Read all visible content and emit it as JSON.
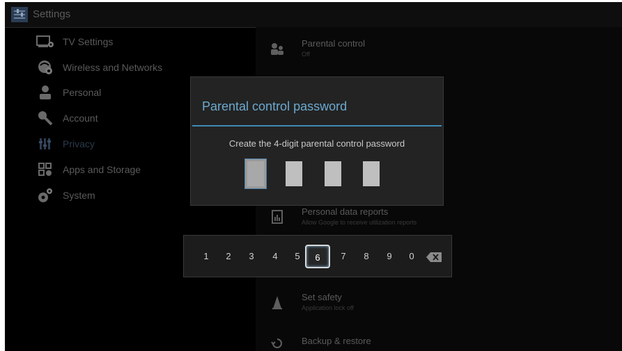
{
  "header": {
    "title": "Settings",
    "icon": "settings-app-icon"
  },
  "menu": {
    "items": [
      {
        "label": "TV Settings",
        "icon": "tv-settings-icon"
      },
      {
        "label": "Wireless and Networks",
        "icon": "network-icon"
      },
      {
        "label": "Personal",
        "icon": "person-icon"
      },
      {
        "label": "Account",
        "icon": "key-icon"
      },
      {
        "label": "Privacy",
        "icon": "privacy-icon",
        "selected": true
      },
      {
        "label": "Apps and Storage",
        "icon": "apps-icon"
      },
      {
        "label": "System",
        "icon": "gears-icon"
      }
    ]
  },
  "settings": {
    "items": [
      {
        "title": "Parental control",
        "subtitle": "Off",
        "icon": "parental-icon"
      },
      {
        "title": "Personal data reports",
        "subtitle": "Allow Google to receive utilization reports",
        "icon": "report-icon"
      },
      {
        "title": "Set safety",
        "subtitle": "Application lock off",
        "icon": "safety-icon"
      },
      {
        "title": "Backup & restore",
        "subtitle": "",
        "icon": "backup-icon"
      }
    ]
  },
  "dialog": {
    "title": "Parental control password",
    "prompt": "Create the 4-digit parental control password",
    "digits_entered": 0,
    "focused_field": 1
  },
  "keypad": {
    "keys": [
      "1",
      "2",
      "3",
      "4",
      "5",
      "6",
      "7",
      "8",
      "9",
      "0"
    ],
    "focused_key": "6",
    "backspace_icon": "backspace-icon"
  },
  "colors": {
    "accent": "#3e8bb8",
    "dialog_bg": "#232323",
    "background": "#000000"
  }
}
